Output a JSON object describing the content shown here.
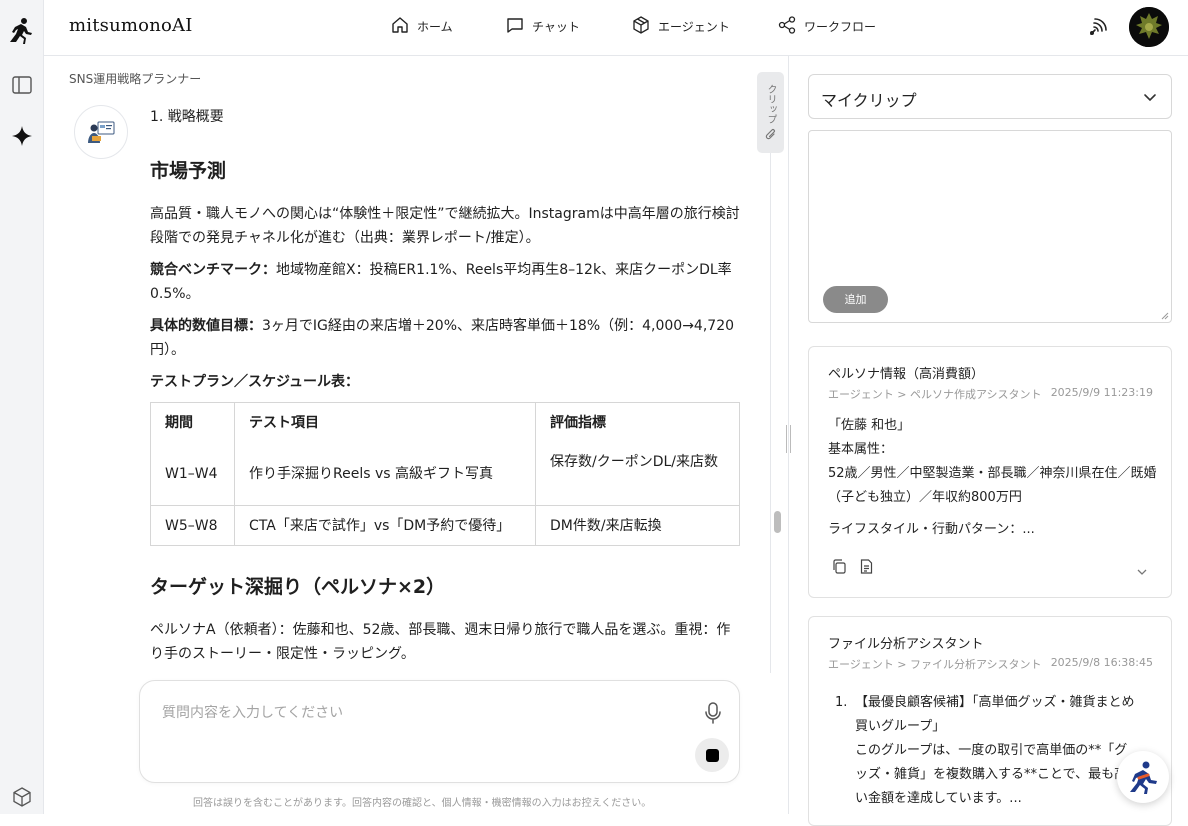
{
  "app": {
    "brand": "mitsumonoAI"
  },
  "nav": {
    "home": "ホーム",
    "chat": "チャット",
    "agent": "エージェント",
    "workflow": "ワークフロー"
  },
  "chat": {
    "breadcrumb": "SNS運用戦略プランナー",
    "section_intro": "1. 戦略概要",
    "h_market": "市場予測",
    "p_market": "高品質・職人モノへの関心は“体験性＋限定性”で継続拡大。Instagramは中高年層の旅行検討段階での発見チャネル化が進む（出典：業界レポート/推定）。",
    "competitor_label": "競合ベンチマーク：",
    "competitor_text": "地域物産館X：投稿ER1.1%、Reels平均再生8–12k、来店クーポンDL率0.5%。",
    "target_label": "具体的数値目標：",
    "target_text": "3ヶ月でIG経由の来店増＋20%、来店時客単価＋18%（例：4,000→4,720円）。",
    "testplan_label": "テストプラン／スケジュール表：",
    "table": {
      "headers": [
        "期間",
        "テスト項目",
        "評価指標"
      ],
      "rows": [
        [
          "W1–W4",
          "作り手深掘りReels vs 高級ギフト写真",
          "保存数/クーポンDL/来店数"
        ],
        [
          "W5–W8",
          "CTA「来店で試作」vs「DM予約で優待」",
          "DM件数/来店転換"
        ]
      ]
    },
    "h_persona": "ターゲット深掘り（ペルソナ×2）",
    "p_persona": "ペルソナA（依頼者）：佐藤和也、52歳、部長職、週末日帰り旅行で職人品を選ぶ。重視：作り手のストーリー・限定性・ラッピング。"
  },
  "clip_tab": "クリップ",
  "input": {
    "placeholder": "質問内容を入力してください",
    "disclaimer": "回答は誤りを含むことがあります。回答内容の確認と、個人情報・機密情報の入力はお控えください。"
  },
  "right": {
    "select_value": "マイクリップ",
    "add_button": "追加",
    "cards": [
      {
        "title": "ペルソナ情報（高消費額）",
        "meta": "エージェント > ペルソナ作成アシスタント",
        "date": "2025/9/9 11:23:19",
        "lines": [
          "「佐藤 和也」",
          "基本属性：",
          "52歳／男性／中堅製造業・部長職／神奈川県在住／既婚（子ども独立）／年収約800万円",
          "ライフスタイル・行動パターン：..."
        ]
      },
      {
        "title": "ファイル分析アシスタント",
        "meta": "エージェント > ファイル分析アシスタント",
        "date": "2025/9/8 16:38:45",
        "list_num": "1.",
        "lines": [
          "【最優良顧客候補】「高単価グッズ・雑貨まとめ買いグループ」",
          "このグループは、一度の取引で高単価の**「グッズ・雑貨」を複数購入する**ことで、最も高い金額を達成しています。..."
        ]
      }
    ]
  },
  "colors": {
    "accent": "#1f1f1f",
    "button_gray": "#8a8a8a"
  },
  "icons": [
    "sidebar-toggle-icon",
    "sparkle-icon",
    "cube-icon",
    "home-icon",
    "chat-icon",
    "agent-icon",
    "workflow-icon",
    "voice-icon",
    "paperclip-icon",
    "mic-icon",
    "stop-icon",
    "copy-icon",
    "document-icon",
    "chevron-down-icon"
  ]
}
